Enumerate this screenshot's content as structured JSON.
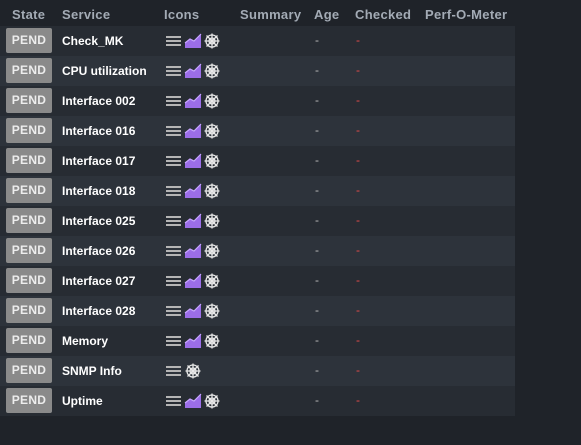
{
  "columns": {
    "state": "State",
    "service": "Service",
    "icons": "Icons",
    "summary": "Summary",
    "age": "Age",
    "checked": "Checked",
    "perf_o_meter": "Perf-O-Meter"
  },
  "colors": {
    "pending_badge": "#8a8a8a",
    "checked_dash": "#e34b4b",
    "graph_icon": "#9b6ee8"
  },
  "services": [
    {
      "state": "PEND",
      "name": "Check_MK",
      "icons": [
        "menu-icon",
        "graph-icon",
        "rule-icon"
      ],
      "summary": "",
      "age": "-",
      "checked": "-"
    },
    {
      "state": "PEND",
      "name": "CPU utilization",
      "icons": [
        "menu-icon",
        "graph-icon",
        "rule-icon"
      ],
      "summary": "",
      "age": "-",
      "checked": "-"
    },
    {
      "state": "PEND",
      "name": "Interface 002",
      "icons": [
        "menu-icon",
        "graph-icon",
        "rule-icon"
      ],
      "summary": "",
      "age": "-",
      "checked": "-"
    },
    {
      "state": "PEND",
      "name": "Interface 016",
      "icons": [
        "menu-icon",
        "graph-icon",
        "rule-icon"
      ],
      "summary": "",
      "age": "-",
      "checked": "-"
    },
    {
      "state": "PEND",
      "name": "Interface 017",
      "icons": [
        "menu-icon",
        "graph-icon",
        "rule-icon"
      ],
      "summary": "",
      "age": "-",
      "checked": "-"
    },
    {
      "state": "PEND",
      "name": "Interface 018",
      "icons": [
        "menu-icon",
        "graph-icon",
        "rule-icon"
      ],
      "summary": "",
      "age": "-",
      "checked": "-"
    },
    {
      "state": "PEND",
      "name": "Interface 025",
      "icons": [
        "menu-icon",
        "graph-icon",
        "rule-icon"
      ],
      "summary": "",
      "age": "-",
      "checked": "-"
    },
    {
      "state": "PEND",
      "name": "Interface 026",
      "icons": [
        "menu-icon",
        "graph-icon",
        "rule-icon"
      ],
      "summary": "",
      "age": "-",
      "checked": "-"
    },
    {
      "state": "PEND",
      "name": "Interface 027",
      "icons": [
        "menu-icon",
        "graph-icon",
        "rule-icon"
      ],
      "summary": "",
      "age": "-",
      "checked": "-"
    },
    {
      "state": "PEND",
      "name": "Interface 028",
      "icons": [
        "menu-icon",
        "graph-icon",
        "rule-icon"
      ],
      "summary": "",
      "age": "-",
      "checked": "-"
    },
    {
      "state": "PEND",
      "name": "Memory",
      "icons": [
        "menu-icon",
        "graph-icon",
        "rule-icon"
      ],
      "summary": "",
      "age": "-",
      "checked": "-"
    },
    {
      "state": "PEND",
      "name": "SNMP Info",
      "icons": [
        "menu-icon",
        "rule-icon"
      ],
      "summary": "",
      "age": "-",
      "checked": "-"
    },
    {
      "state": "PEND",
      "name": "Uptime",
      "icons": [
        "menu-icon",
        "graph-icon",
        "rule-icon"
      ],
      "summary": "",
      "age": "-",
      "checked": "-"
    }
  ]
}
